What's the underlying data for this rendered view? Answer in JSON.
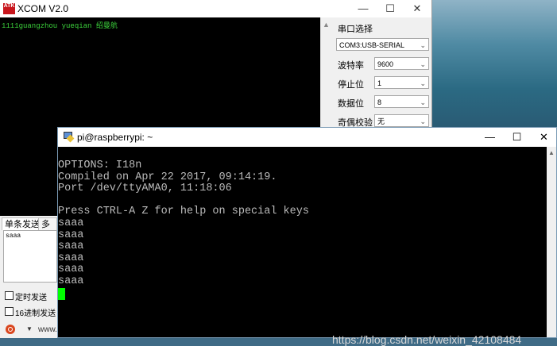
{
  "xcom": {
    "title": "XCOM V2.0",
    "logo_text": "ATK",
    "window_controls": {
      "minimize": "—",
      "maximize": "☐",
      "close": "✕"
    },
    "receive_text": "1111guangzhou yueqian 绍曼航",
    "serial_section_label": "串口选择",
    "port_select": "COM3:USB-SERIAL",
    "baud_label": "波特率",
    "baud_value": "9600",
    "stop_label": "停止位",
    "stop_value": "1",
    "data_label": "数据位",
    "data_value": "8",
    "parity_label": "奇偶校验",
    "parity_value": "无",
    "tabs": [
      "单条发送",
      "多条"
    ],
    "send_text": "saaa",
    "timed_send_label": "定时发送",
    "hex_send_label": "16进制发送",
    "status_text": "www."
  },
  "putty": {
    "title": "pi@raspberrypi: ~",
    "window_controls": {
      "minimize": "—",
      "maximize": "☐",
      "close": "✕"
    },
    "lines": [
      "OPTIONS: I18n",
      "Compiled on Apr 22 2017, 09:14:19.",
      "Port /dev/ttyAMA0, 11:18:06",
      "",
      "Press CTRL-A Z for help on special keys",
      "saaa",
      "saaa",
      "saaa",
      "saaa",
      "saaa",
      "saaa"
    ]
  },
  "watermark": "https://blog.csdn.net/weixin_42108484",
  "colors": {
    "xcom_text": "#3cd23c",
    "putty_text": "#bbbbbb",
    "cursor": "#00ff00"
  }
}
